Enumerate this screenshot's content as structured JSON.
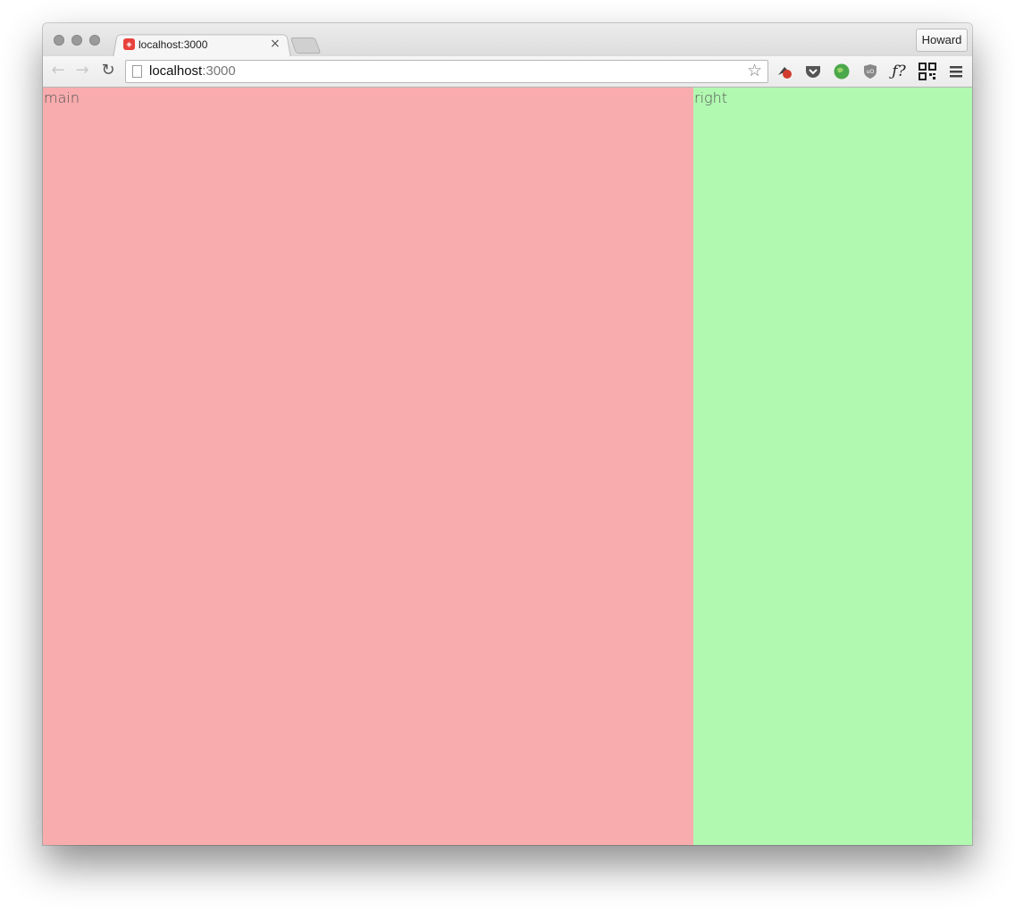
{
  "browser": {
    "tab_title": "localhost:3000",
    "tab_close": "×",
    "profile_name": "Howard",
    "url_host": "localhost",
    "url_port": ":3000",
    "icons": {
      "back": "arrow-left",
      "forward": "arrow-right",
      "reload": "reload",
      "bookmark": "star",
      "menu": "hamburger"
    },
    "extensions": [
      "lastpass-icon",
      "pocket-icon",
      "globe-icon",
      "ublock-icon",
      "font-finder-icon",
      "qr-code-icon"
    ]
  },
  "page": {
    "main_label": "main",
    "right_label": "right",
    "main_color": "#f8acae",
    "right_color": "#b1f8b1"
  }
}
